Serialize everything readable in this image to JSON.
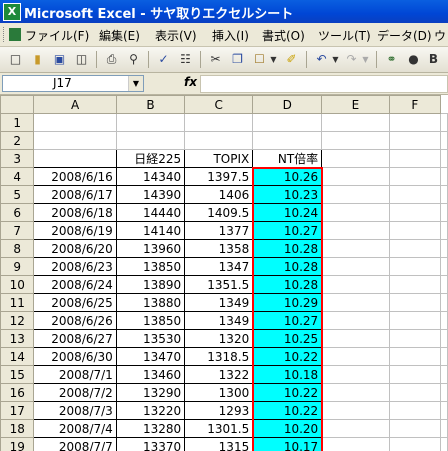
{
  "window": {
    "title": "Microsoft Excel - サヤ取りエクセルシート"
  },
  "menu": [
    "ファイル(F)",
    "編集(E)",
    "表示(V)",
    "挿入(I)",
    "書式(O)",
    "ツール(T)",
    "データ(D)",
    "ウ"
  ],
  "formula_bar": {
    "name_box": "J17",
    "fx_label": "fx",
    "content": ""
  },
  "columns": [
    "A",
    "B",
    "C",
    "D",
    "E",
    "F"
  ],
  "rows": [
    {
      "n": "1",
      "a": "",
      "b": "",
      "c": "",
      "d": ""
    },
    {
      "n": "2",
      "a": "",
      "b": "",
      "c": "",
      "d": ""
    },
    {
      "n": "3",
      "a": "",
      "b": "日経225",
      "c": "TOPIX",
      "d": "NT倍率"
    },
    {
      "n": "4",
      "a": "2008/6/16",
      "b": "14340",
      "c": "1397.5",
      "d": "10.26"
    },
    {
      "n": "5",
      "a": "2008/6/17",
      "b": "14390",
      "c": "1406",
      "d": "10.23"
    },
    {
      "n": "6",
      "a": "2008/6/18",
      "b": "14440",
      "c": "1409.5",
      "d": "10.24"
    },
    {
      "n": "7",
      "a": "2008/6/19",
      "b": "14140",
      "c": "1377",
      "d": "10.27"
    },
    {
      "n": "8",
      "a": "2008/6/20",
      "b": "13960",
      "c": "1358",
      "d": "10.28"
    },
    {
      "n": "9",
      "a": "2008/6/23",
      "b": "13850",
      "c": "1347",
      "d": "10.28"
    },
    {
      "n": "10",
      "a": "2008/6/24",
      "b": "13890",
      "c": "1351.5",
      "d": "10.28"
    },
    {
      "n": "11",
      "a": "2008/6/25",
      "b": "13880",
      "c": "1349",
      "d": "10.29"
    },
    {
      "n": "12",
      "a": "2008/6/26",
      "b": "13850",
      "c": "1349",
      "d": "10.27"
    },
    {
      "n": "13",
      "a": "2008/6/27",
      "b": "13530",
      "c": "1320",
      "d": "10.25"
    },
    {
      "n": "14",
      "a": "2008/6/30",
      "b": "13470",
      "c": "1318.5",
      "d": "10.22"
    },
    {
      "n": "15",
      "a": "2008/7/1",
      "b": "13460",
      "c": "1322",
      "d": "10.18"
    },
    {
      "n": "16",
      "a": "2008/7/2",
      "b": "13290",
      "c": "1300",
      "d": "10.22"
    },
    {
      "n": "17",
      "a": "2008/7/3",
      "b": "13220",
      "c": "1293",
      "d": "10.22"
    },
    {
      "n": "18",
      "a": "2008/7/4",
      "b": "13280",
      "c": "1301.5",
      "d": "10.20"
    },
    {
      "n": "19",
      "a": "2008/7/7",
      "b": "13370",
      "c": "1315",
      "d": "10.17"
    }
  ],
  "colors": {
    "highlight_fill": "#00ffff",
    "highlight_border": "#ff0000",
    "title_bar": "#0046d5"
  }
}
